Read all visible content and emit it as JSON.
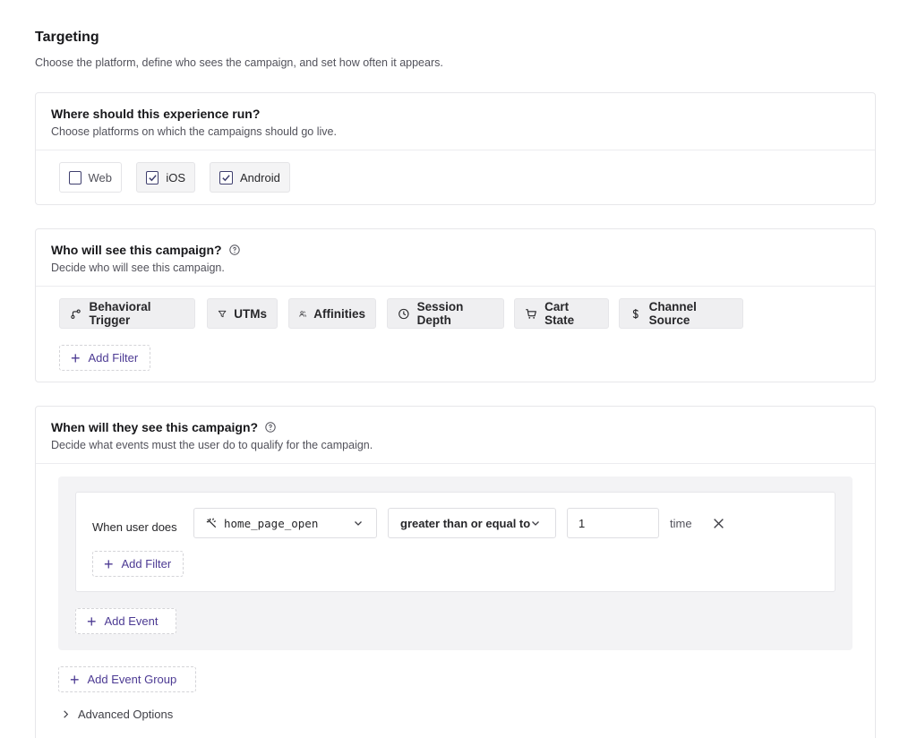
{
  "header": {
    "title": "Targeting",
    "subtitle": "Choose the platform, define who sees the campaign, and set how often it appears."
  },
  "platforms": {
    "title": "Where should this experience run?",
    "description": "Choose platforms on which the campaigns should go live.",
    "options": [
      {
        "label": "Web",
        "checked": false
      },
      {
        "label": "iOS",
        "checked": true
      },
      {
        "label": "Android",
        "checked": true
      }
    ]
  },
  "audience": {
    "title": "Who will see this campaign?",
    "description": "Decide who will see this campaign.",
    "filters": [
      {
        "label": "Behavioral Trigger",
        "icon": "behavioral-trigger-icon"
      },
      {
        "label": "UTMs",
        "icon": "funnel-icon"
      },
      {
        "label": "Affinities",
        "icon": "users-icon"
      },
      {
        "label": "Session Depth",
        "icon": "clock-icon"
      },
      {
        "label": "Cart State",
        "icon": "cart-icon"
      },
      {
        "label": "Channel Source",
        "icon": "dollar-icon"
      }
    ],
    "add_filter_label": "Add Filter"
  },
  "timing": {
    "title": "When will they see this campaign?",
    "description": "Decide what events must the user do to qualify for the campaign.",
    "event": {
      "prefix": "When user does",
      "event_name": "home_page_open",
      "operator": "greater than or equal to",
      "value": "1",
      "unit": "time",
      "add_filter_label": "Add Filter"
    },
    "add_event_label": "Add Event",
    "add_event_group_label": "Add Event Group",
    "advanced_options_label": "Advanced Options"
  },
  "colors": {
    "accent": "#4c3a93",
    "chip_bg": "#efeff1",
    "group_bg": "#f3f3f5"
  }
}
